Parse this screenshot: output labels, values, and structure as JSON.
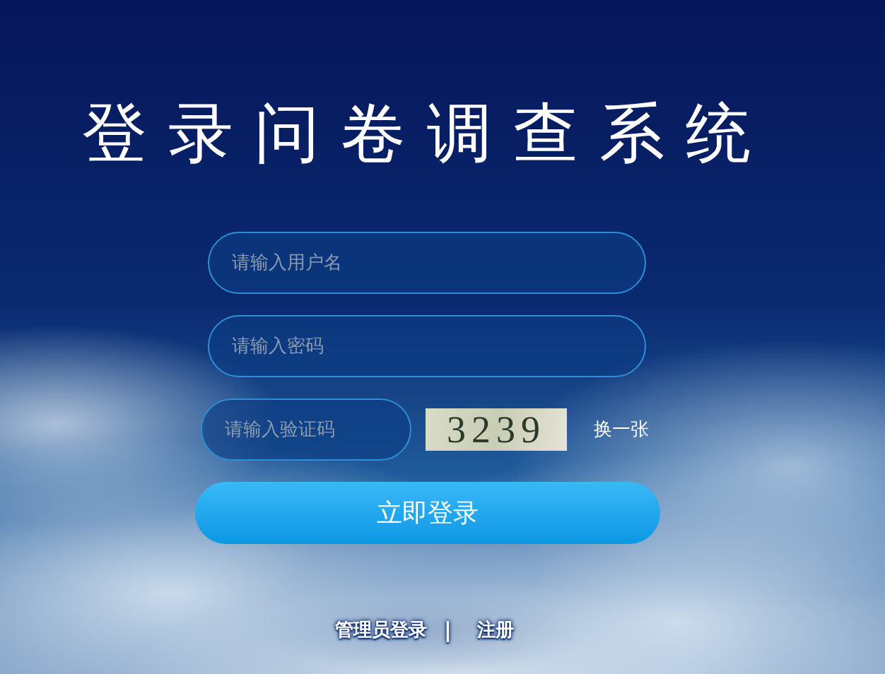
{
  "title": "登录问卷调查系统",
  "fields": [
    {
      "placeholder": "请输入用户名"
    },
    {
      "placeholder": "请输入密码"
    }
  ],
  "captcha": {
    "placeholder": "请输入验证码",
    "code": "3239",
    "refresh": "换一张"
  },
  "submit": "立即登录",
  "footer": {
    "links": [
      "管理员登录",
      "注册"
    ],
    "separator": "|"
  }
}
